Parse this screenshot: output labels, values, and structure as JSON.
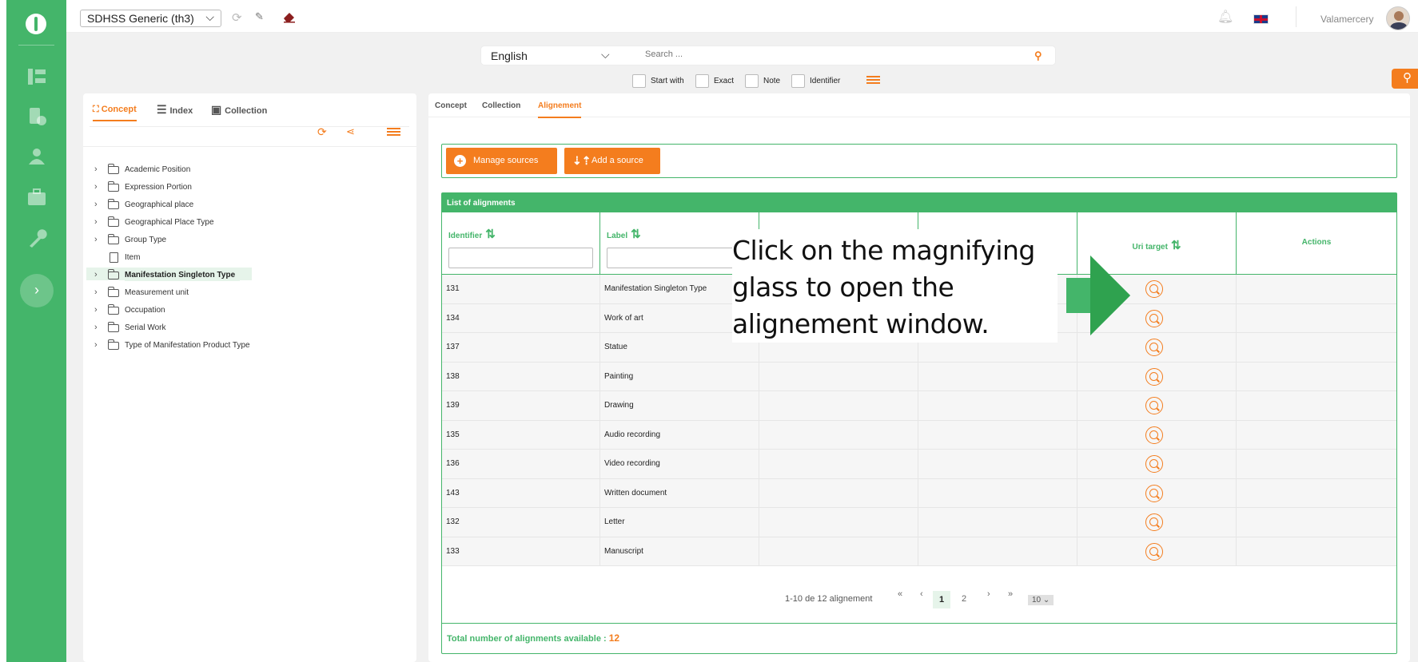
{
  "topbar": {
    "thesaurus": "SDHSS Generic (th3)",
    "username": "Valamercery"
  },
  "search": {
    "language": "English",
    "placeholder": "Search ...",
    "filters": [
      "Start with",
      "Exact",
      "Note",
      "Identifier"
    ]
  },
  "left_panel": {
    "tabs": [
      "Concept",
      "Index",
      "Collection"
    ],
    "tree": [
      {
        "label": "Academic Position",
        "type": "folder"
      },
      {
        "label": "Expression Portion",
        "type": "folder"
      },
      {
        "label": "Geographical place",
        "type": "folder"
      },
      {
        "label": "Geographical Place Type",
        "type": "folder"
      },
      {
        "label": "Group Type",
        "type": "folder"
      },
      {
        "label": "Item",
        "type": "doc"
      },
      {
        "label": "Manifestation Singleton Type",
        "type": "folder",
        "selected": true
      },
      {
        "label": "Measurement unit",
        "type": "folder"
      },
      {
        "label": "Occupation",
        "type": "folder"
      },
      {
        "label": "Serial Work",
        "type": "folder"
      },
      {
        "label": "Type of Manifestation Product Type",
        "type": "folder"
      }
    ]
  },
  "main": {
    "tabs": [
      "Concept",
      "Collection",
      "Alignement"
    ],
    "active_tab": "Alignement",
    "manage_sources": "Manage sources",
    "add_source": "Add a source",
    "list_title": "List of alignments",
    "columns": {
      "identifier": "Identifier",
      "label": "Label",
      "uri_target": "Uri target",
      "actions": "Actions"
    },
    "rows": [
      {
        "id": "131",
        "label": "Manifestation Singleton Type"
      },
      {
        "id": "134",
        "label": "Work of art"
      },
      {
        "id": "137",
        "label": "Statue"
      },
      {
        "id": "138",
        "label": "Painting"
      },
      {
        "id": "139",
        "label": "Drawing"
      },
      {
        "id": "135",
        "label": "Audio recording"
      },
      {
        "id": "136",
        "label": "Video recording"
      },
      {
        "id": "143",
        "label": "Written document"
      },
      {
        "id": "132",
        "label": "Letter"
      },
      {
        "id": "133",
        "label": "Manuscript"
      }
    ],
    "pager": {
      "info": "1-10 de 12 alignement",
      "first": "«",
      "prev": "‹",
      "pages": [
        "1",
        "2"
      ],
      "next": "›",
      "last": "»",
      "per_page": "10 ⌄"
    },
    "total_label": "Total number of alignments available :",
    "total_value": "12"
  },
  "callout": {
    "line1": "Click on the magnifying",
    "line2": "glass to open the",
    "line3": "alignement window."
  },
  "colors": {
    "green": "#44b56a",
    "orange": "#f47d1e"
  }
}
